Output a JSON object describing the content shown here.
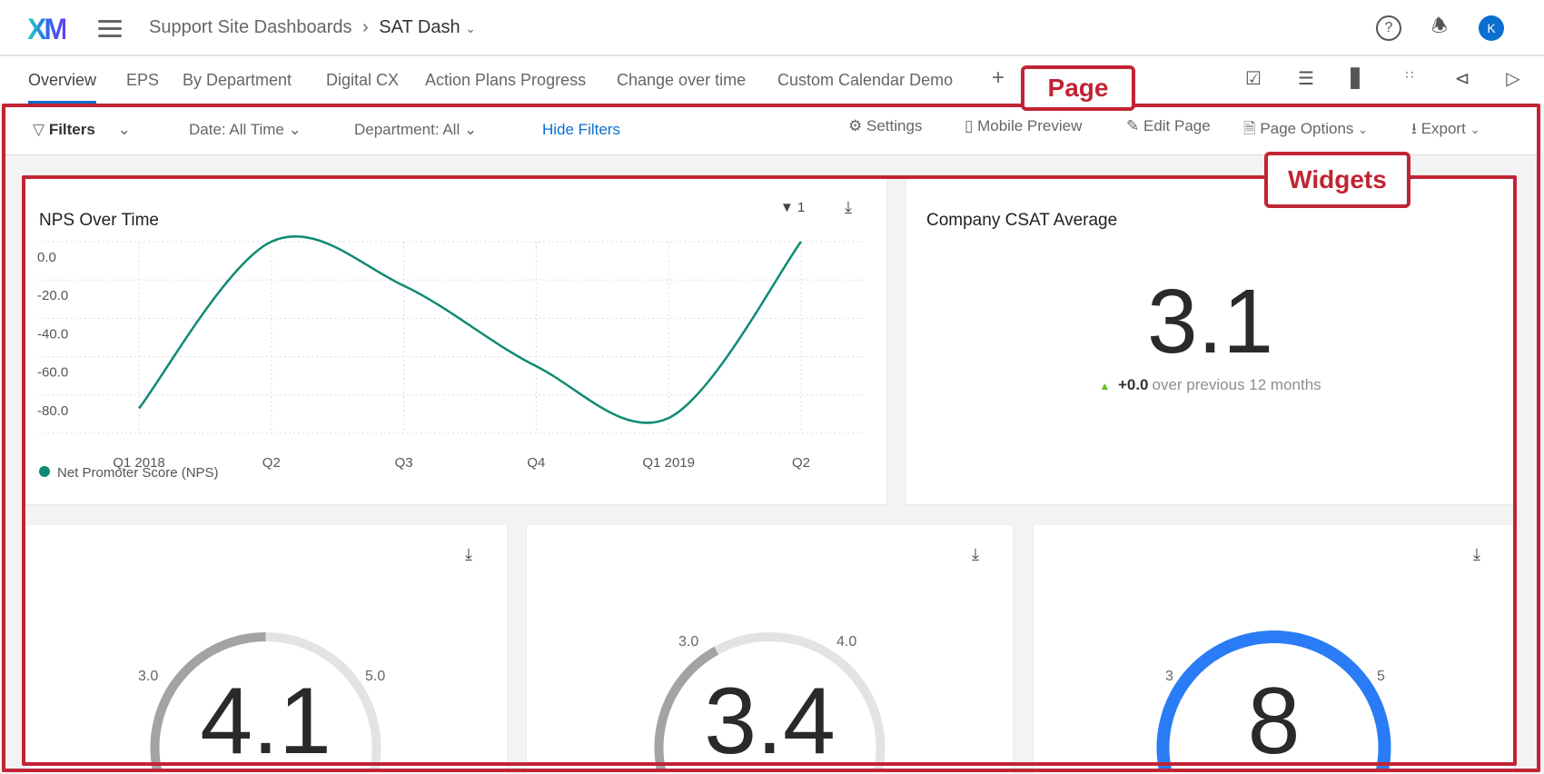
{
  "header": {
    "logo": "XM",
    "breadcrumb_parent": "Support Site Dashboards",
    "breadcrumb_sep": "›",
    "dashboard": "SAT Dash",
    "avatar": "K",
    "help": "?"
  },
  "tabs": [
    {
      "label": "Overview",
      "active": true
    },
    {
      "label": "EPS"
    },
    {
      "label": "By Department"
    },
    {
      "label": "Digital CX"
    },
    {
      "label": "Action Plans Progress"
    },
    {
      "label": "Change over time"
    },
    {
      "label": "Custom Calendar Demo"
    }
  ],
  "add_tab": "+",
  "filters": {
    "label": "Filters",
    "date": "Date: All Time",
    "department": "Department:  All",
    "hide": "Hide Filters"
  },
  "toolbar": {
    "settings": "Settings",
    "mobile": "Mobile Preview",
    "edit": "Edit Page",
    "options": "Page Options",
    "export": "Export"
  },
  "annotations": {
    "page": "Page",
    "widgets": "Widgets"
  },
  "nps": {
    "title": "NPS Over Time",
    "filter_count": "1",
    "legend": "Net Promoter Score (NPS)"
  },
  "chart_data": {
    "type": "line",
    "title": "NPS Over Time",
    "categories": [
      "Q1 2018",
      "Q2",
      "Q3",
      "Q4",
      "Q1 2019",
      "Q2"
    ],
    "series": [
      {
        "name": "Net Promoter Score (NPS)",
        "values": [
          -87,
          0,
          -23,
          -65,
          -92,
          0
        ],
        "color": "#0e8a74"
      }
    ],
    "yticks": [
      "0.0",
      "-20.0",
      "-40.0",
      "-60.0",
      "-80.0"
    ],
    "ylim": [
      -100,
      0
    ],
    "grid": true,
    "legend": "bottom-left"
  },
  "csat": {
    "title": "Company CSAT Average",
    "value": "3.1",
    "change": "+0.0",
    "change_text": "over previous 12 months",
    "up_color": "#5bc21c"
  },
  "gauges": [
    {
      "value": "4.1",
      "min_label": "3.0",
      "max_label": "5.0",
      "fill": 0.5,
      "color": "#a3a3a3"
    },
    {
      "value": "3.4",
      "min_label": "3.0",
      "max_label": "4.0",
      "fill": 0.42,
      "color": "#a3a3a3"
    },
    {
      "value": "8",
      "min_label": "3",
      "max_label": "5",
      "fill": 1,
      "color": "#2a7cf6"
    }
  ]
}
